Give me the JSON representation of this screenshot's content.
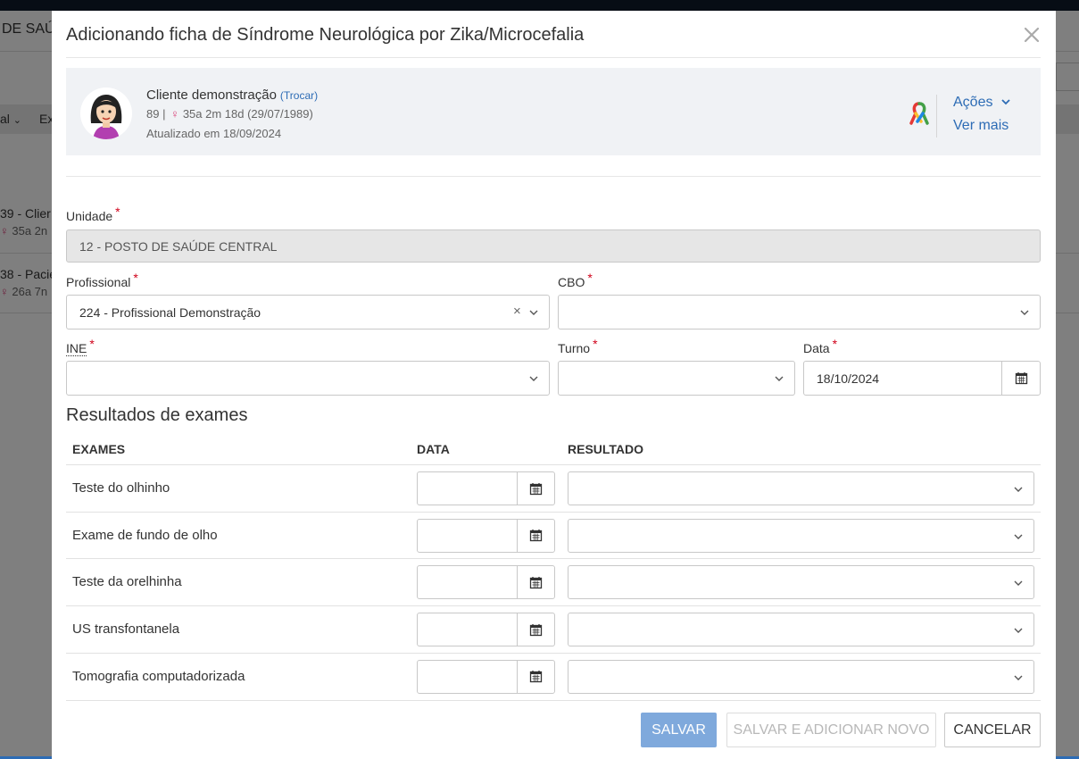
{
  "background": {
    "title": "DE SAÚ",
    "tabs": [
      "al",
      "Ex"
    ],
    "rows": [
      {
        "name": "39 - Clier",
        "sub_sex": "♀",
        "sub": "35a 2n"
      },
      {
        "name": "38 - Pacie",
        "sub_sex": "♀",
        "sub": "26a 7n"
      }
    ]
  },
  "modal": {
    "title": "Adicionando ficha de Síndrome Neurológica por Zika/Microcefalia",
    "close_icon": "close-icon"
  },
  "patient": {
    "name": "Cliente demonstração",
    "swap_label": "(Trocar)",
    "id": "89 |",
    "sex_symbol": "♀",
    "age": "35a 2m 18d (29/07/1989)",
    "updated": "Atualizado em 18/09/2024",
    "actions_label": "Ações",
    "see_more_label": "Ver mais"
  },
  "form": {
    "unidade": {
      "label": "Unidade",
      "required": "*",
      "value": "12 - POSTO DE SAÚDE CENTRAL"
    },
    "profissional": {
      "label": "Profissional",
      "required": "*",
      "value": "224 - Profissional Demonstração",
      "clear": "×"
    },
    "cbo": {
      "label": "CBO",
      "required": "*",
      "value": ""
    },
    "ine": {
      "label": "INE",
      "required": "*",
      "value": ""
    },
    "turno": {
      "label": "Turno",
      "required": "*",
      "value": ""
    },
    "data": {
      "label": "Data",
      "required": "*",
      "value": "18/10/2024"
    }
  },
  "exams": {
    "title": "Resultados de exames",
    "headers": {
      "exam": "EXAMES",
      "date": "DATA",
      "result": "RESULTADO"
    },
    "rows": [
      {
        "name": "Teste do olhinho",
        "date": "",
        "result": ""
      },
      {
        "name": "Exame de fundo de olho",
        "date": "",
        "result": ""
      },
      {
        "name": "Teste da orelhinha",
        "date": "",
        "result": ""
      },
      {
        "name": "US transfontanela",
        "date": "",
        "result": ""
      },
      {
        "name": "Tomografia computadorizada",
        "date": "",
        "result": ""
      }
    ]
  },
  "buttons": {
    "save": "SALVAR",
    "save_new": "SALVAR E ADICIONAR NOVO",
    "cancel": "CANCELAR"
  },
  "colors": {
    "accent": "#2d6cb5",
    "save_button": "#7fa9dc",
    "required": "#d0021b",
    "female_symbol": "#d9437a"
  }
}
